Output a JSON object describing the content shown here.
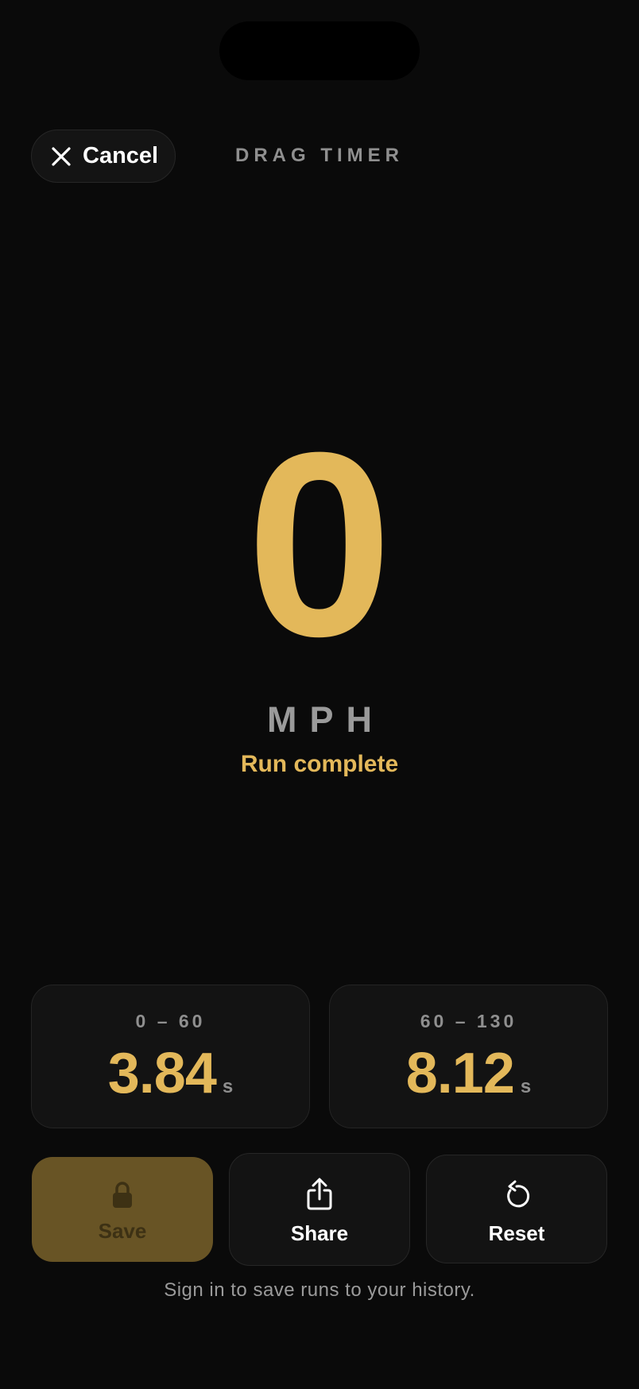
{
  "header": {
    "cancel_label": "Cancel",
    "title": "DRAG TIMER"
  },
  "speedometer": {
    "value": "0",
    "unit": "MPH",
    "status": "Run complete"
  },
  "splits": [
    {
      "label": "0 – 60",
      "value": "3.84",
      "unit": "s"
    },
    {
      "label": "60 – 130",
      "value": "8.12",
      "unit": "s"
    }
  ],
  "actions": {
    "save_label": "Save",
    "share_label": "Share",
    "reset_label": "Reset"
  },
  "footer": {
    "hint": "Sign in to save runs to your history."
  },
  "icons": {
    "cancel": "close-icon",
    "save": "lock-icon",
    "share": "share-icon",
    "reset": "reset-icon"
  },
  "colors": {
    "accent": "#e3b85a",
    "background": "#0a0a0a",
    "card": "#131313",
    "save_button": "#685425",
    "muted_text": "#8f8f8f"
  }
}
